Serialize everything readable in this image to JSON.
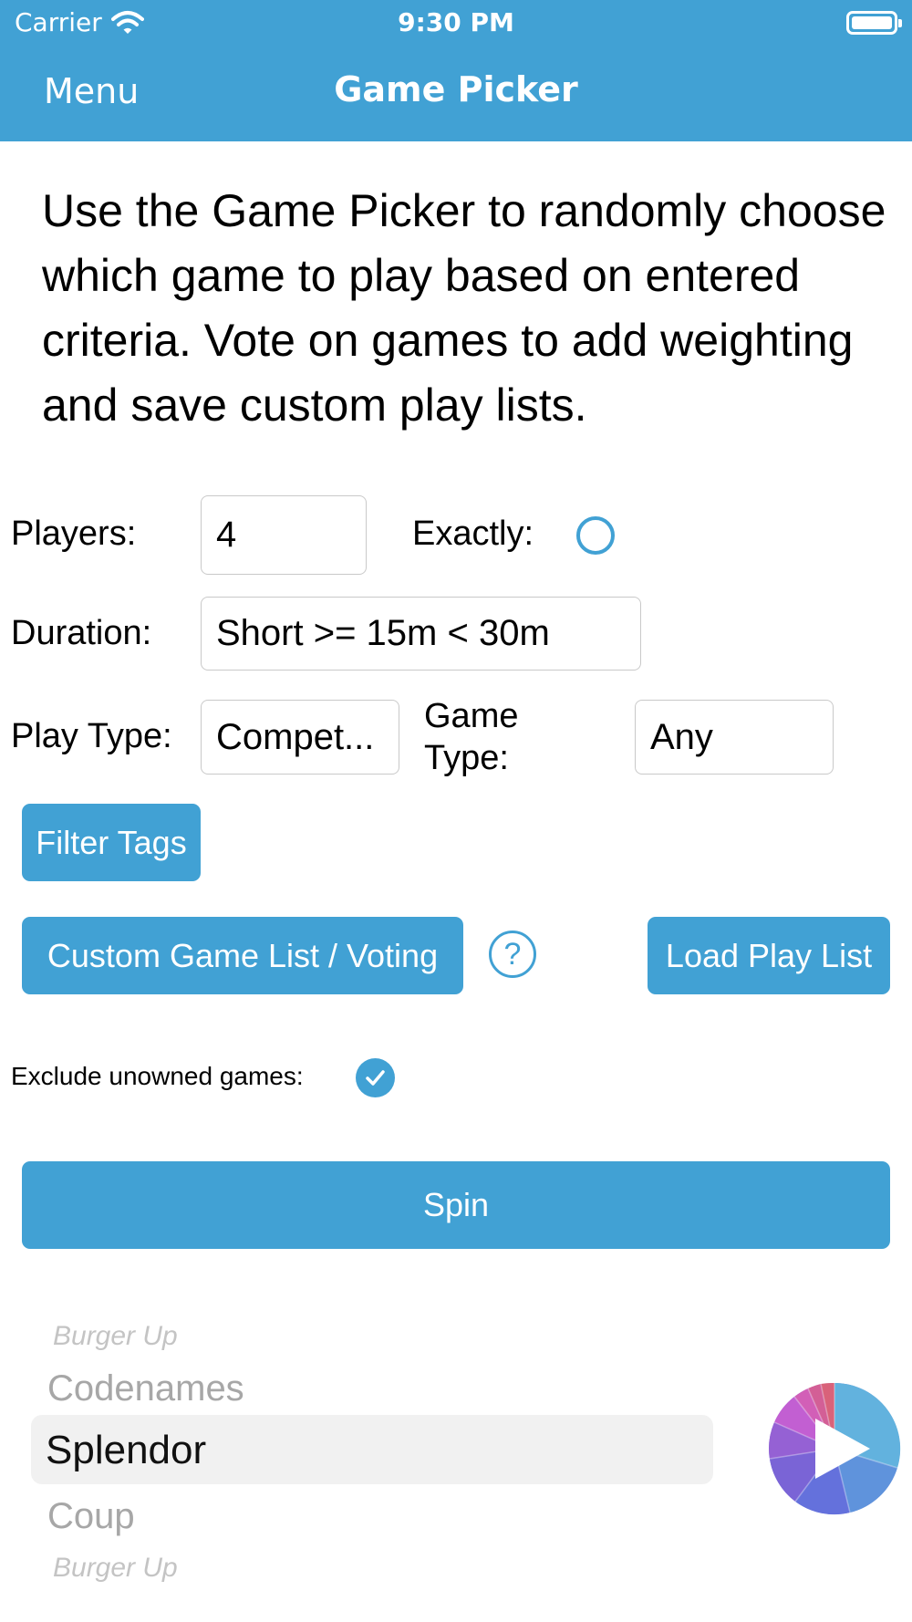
{
  "status_bar": {
    "carrier": "Carrier",
    "time": "9:30 PM",
    "icons": [
      "wifi-icon",
      "battery-icon"
    ]
  },
  "nav": {
    "menu": "Menu",
    "title": "Game Picker"
  },
  "intro_text": "Use the Game Picker to randomly choose which game to play based on entered criteria. Vote on games to add weighting and save custom play lists.",
  "form": {
    "players_label": "Players:",
    "players_value": "4",
    "exactly_label": "Exactly:",
    "exactly_checked": false,
    "duration_label": "Duration:",
    "duration_value": "Short >= 15m < 30m",
    "play_type_label": "Play Type:",
    "play_type_value": "Compet...",
    "game_type_label_line1": "Game",
    "game_type_label_line2": "Type:",
    "game_type_value": "Any"
  },
  "buttons": {
    "filter_tags": "Filter Tags",
    "custom_list": "Custom Game List / Voting",
    "help": "?",
    "load_play_list": "Load Play List",
    "spin": "Spin"
  },
  "exclude": {
    "label": "Exclude unowned games:",
    "checked": true
  },
  "picker": {
    "items": [
      "Burger Up",
      "Codenames",
      "Splendor",
      "Coup",
      "Burger Up"
    ],
    "selected": "Splendor"
  },
  "colors": {
    "accent": "#41a1d4",
    "field_border": "#c9c9c9",
    "picker_highlight": "#f1f1f1",
    "picker_faded": "#a7a7a7"
  }
}
